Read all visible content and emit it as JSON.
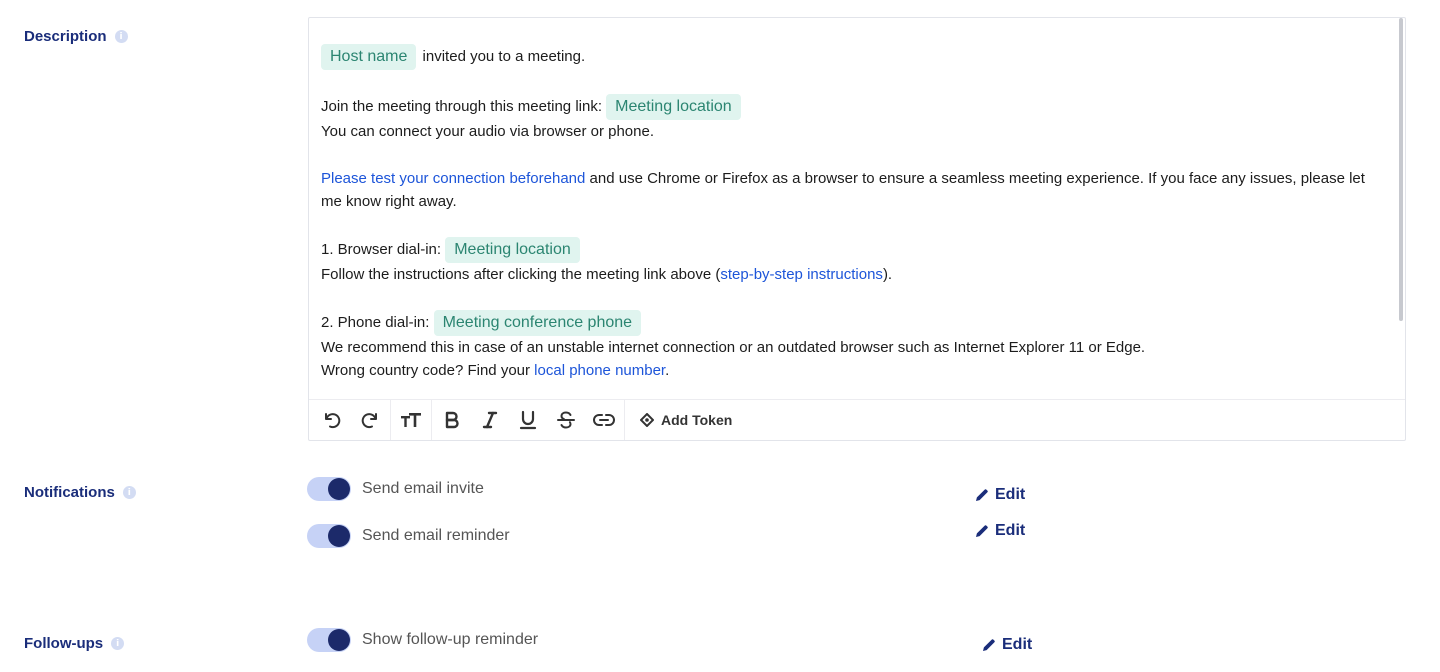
{
  "description": {
    "label": "Description",
    "info_glyph": "i",
    "editor": {
      "p1": {
        "token_host": "Host name",
        "text": "invited you to a meeting."
      },
      "p2": {
        "line1_text": "Join the meeting through this meeting link:",
        "token_location": "Meeting location",
        "line2_text": "You can connect your audio via browser or phone."
      },
      "p3": {
        "link": "Please test your connection beforehand",
        "text": " and use Chrome or Firefox as a browser to ensure a seamless meeting experience. If you face any issues, please let me know right away."
      },
      "p4": {
        "line1_text": "1. Browser dial-in:",
        "token_location": "Meeting location",
        "line2_before": "Follow the instructions after clicking the meeting link above (",
        "line2_link": "step-by-step instructions",
        "line2_after": ")."
      },
      "p5": {
        "line1_text": "2. Phone dial-in:",
        "token_phone": "Meeting conference phone",
        "line2_text": "We recommend this in case of an unstable internet connection or an outdated browser such as Internet Explorer 11 or Edge.",
        "line3_before": "Wrong country code? Find your ",
        "line3_link": "local phone number",
        "line3_after": "."
      }
    },
    "toolbar": {
      "buttons": [
        "undo-icon",
        "redo-icon",
        "text-size-icon",
        "bold-icon",
        "italic-icon",
        "underline-icon",
        "strikethrough-icon",
        "link-icon"
      ],
      "add_token_label": "Add Token"
    }
  },
  "notifications": {
    "label": "Notifications",
    "info_glyph": "i",
    "items": [
      {
        "label": "Send email invite",
        "enabled": true,
        "edit_label": "Edit"
      },
      {
        "label": "Send email reminder",
        "enabled": true,
        "edit_label": "Edit"
      }
    ]
  },
  "followups": {
    "label": "Follow-ups",
    "info_glyph": "i",
    "items": [
      {
        "label": "Show follow-up reminder",
        "enabled": true,
        "edit_label": "Edit"
      }
    ]
  },
  "colors": {
    "label_navy": "#1a2d7a",
    "token_bg": "#e0f4ef",
    "token_text": "#2b8571",
    "link_blue": "#1d55d9",
    "toggle_track": "#c6d2f6",
    "toggle_knob": "#1c2a6a"
  }
}
